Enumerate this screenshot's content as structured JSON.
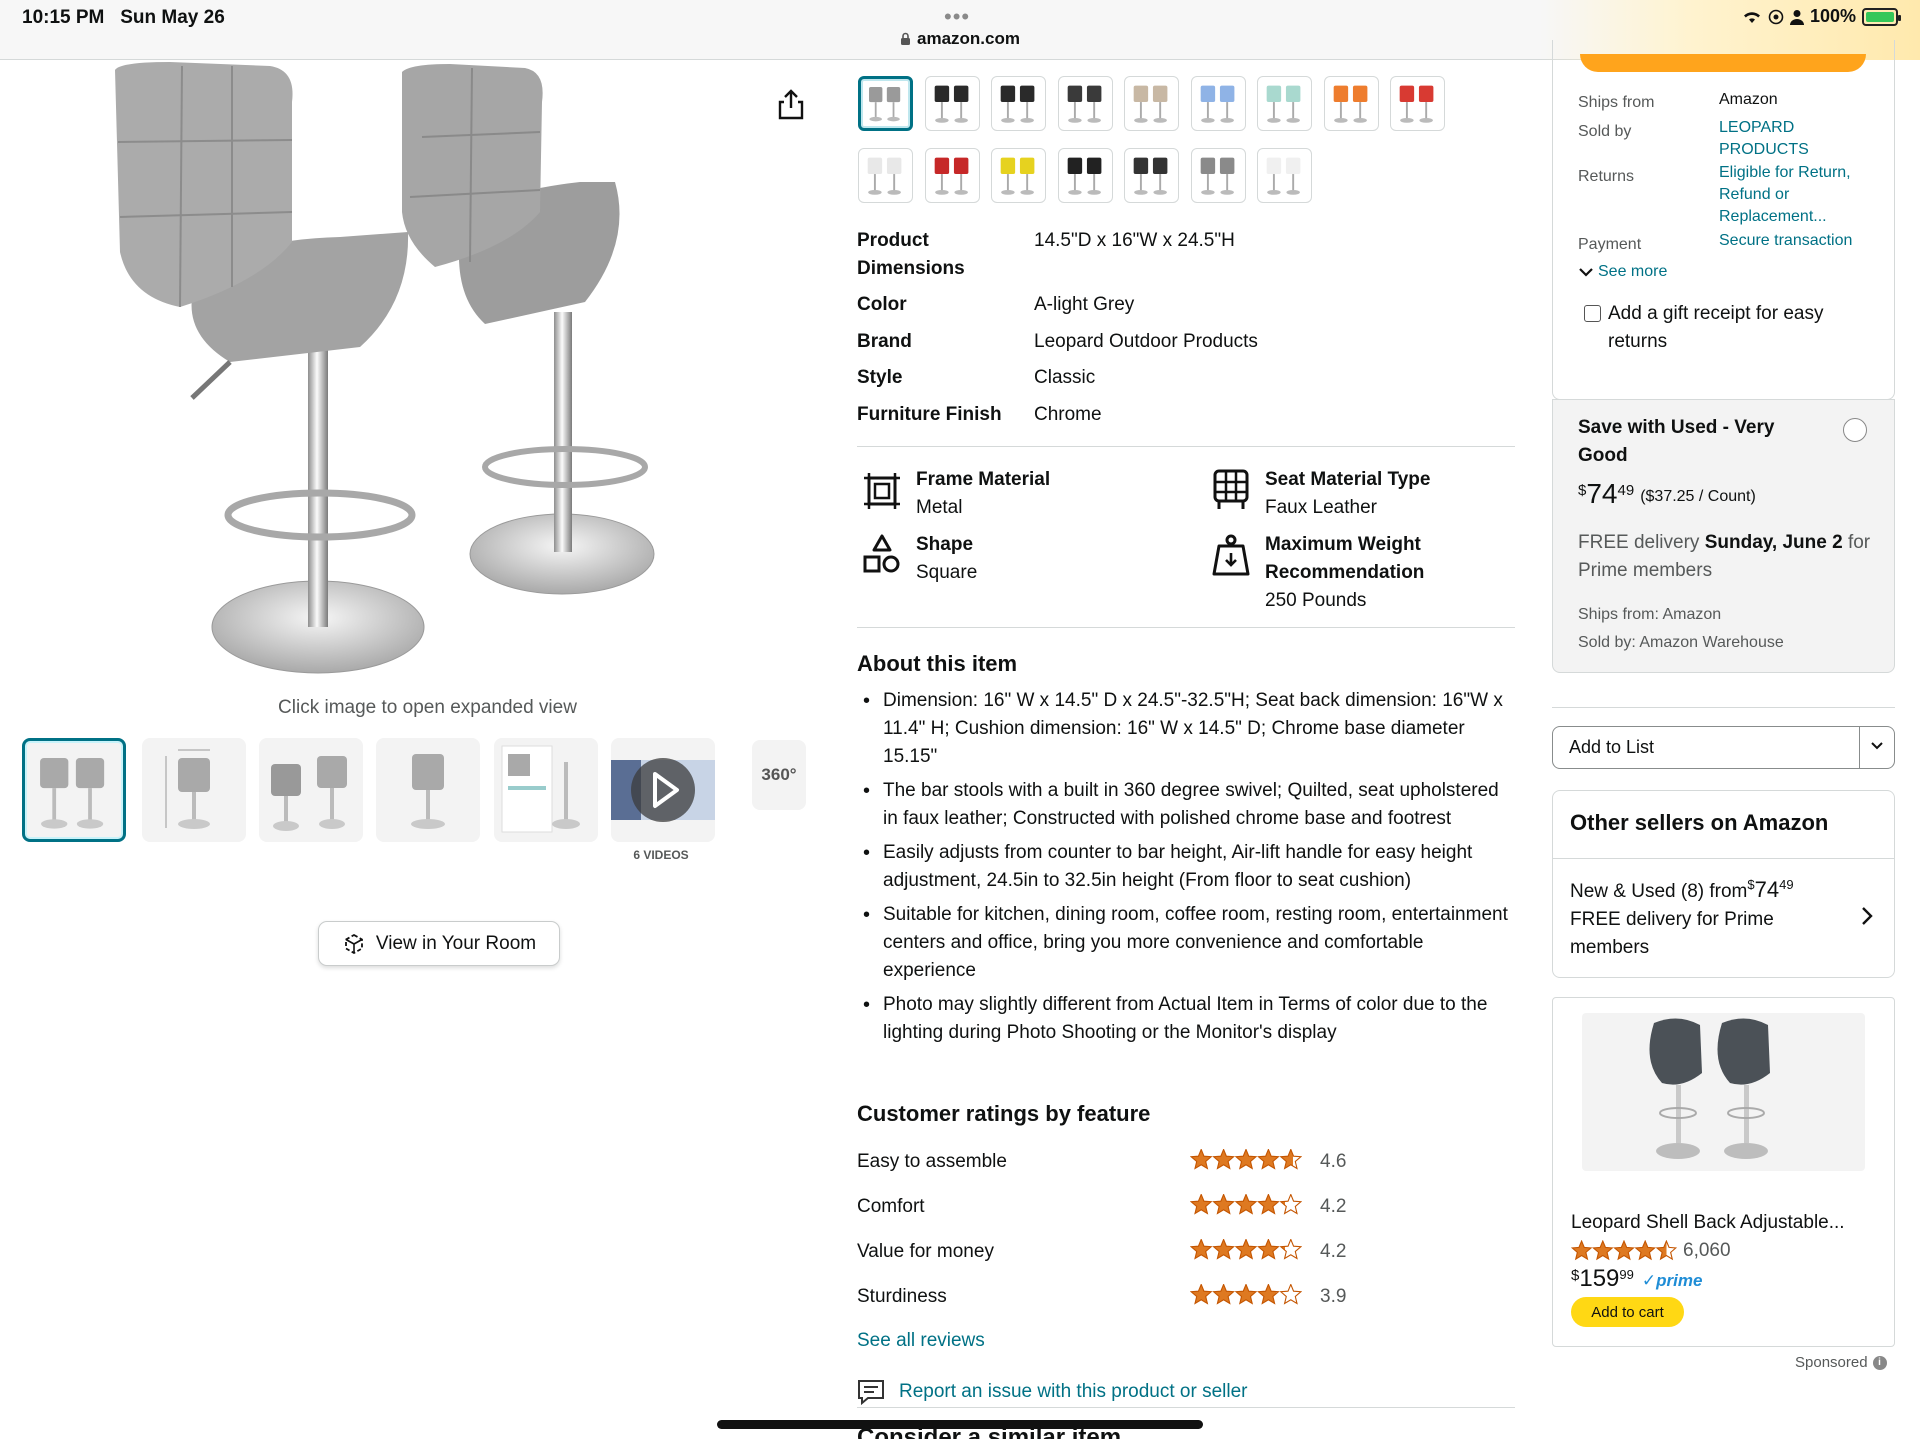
{
  "status_bar": {
    "time": "10:15 PM",
    "date": "Sun May 26",
    "url": "amazon.com",
    "battery": "100%"
  },
  "gallery": {
    "expand_hint": "Click image to open expanded view",
    "videos_label": "6 VIDEOS",
    "view_360": "360°",
    "view_in_room": "View in Your Room"
  },
  "swatch_colors": [
    "#9a9a9a",
    "#2a2a2a",
    "#2a2a2a",
    "#3a3a3a",
    "#c8b8a4",
    "#8fb3e6",
    "#a9d9cf",
    "#ee7d2e",
    "#d83a32",
    "#e8e8e8",
    "#c62828",
    "#e6d21f",
    "#222222",
    "#333333",
    "#8a8a8a",
    "#f0f0f0"
  ],
  "specs": [
    {
      "label": "Product Dimensions",
      "value": "14.5\"D x 16\"W x 24.5\"H"
    },
    {
      "label": "Color",
      "value": "A-light Grey"
    },
    {
      "label": "Brand",
      "value": "Leopard Outdoor Products"
    },
    {
      "label": "Style",
      "value": "Classic"
    },
    {
      "label": "Furniture Finish",
      "value": "Chrome"
    }
  ],
  "features": [
    {
      "title": "Frame Material",
      "value": "Metal",
      "icon": "frame-icon"
    },
    {
      "title": "Seat Material Type",
      "value": "Faux Leather",
      "icon": "seat-icon"
    },
    {
      "title": "Shape",
      "value": "Square",
      "icon": "shape-icon"
    },
    {
      "title": "Maximum Weight Recommendation",
      "value": "250 Pounds",
      "icon": "weight-icon"
    }
  ],
  "about": {
    "title": "About this item",
    "items": [
      "Dimension: 16\" W x 14.5\" D x 24.5\"-32.5\"H; Seat back dimension: 16\"W x 11.4\" H; Cushion dimension: 16\" W x 14.5\" D; Chrome base diameter 15.15\"",
      "The bar stools with a built in 360 degree swivel; Quilted, seat upholstered in faux leather; Constructed with polished chrome base and footrest",
      "Easily adjusts from counter to bar height, Air-lift handle for easy height adjustment, 24.5in to 32.5in height (From floor to seat cushion)",
      "Suitable for kitchen, dining room, coffee room, resting room, entertainment centers and office, bring you more convenience and comfortable experience",
      "Photo may slightly different from Actual Item in Terms of color due to the lighting during Photo Shooting or the Monitor's display"
    ]
  },
  "ratings": {
    "title": "Customer ratings by feature",
    "items": [
      {
        "label": "Easy to assemble",
        "value": "4.6",
        "stars": 4.6
      },
      {
        "label": "Comfort",
        "value": "4.2",
        "stars": 4.2
      },
      {
        "label": "Value for money",
        "value": "4.2",
        "stars": 4.2
      },
      {
        "label": "Sturdiness",
        "value": "3.9",
        "stars": 3.9
      }
    ],
    "see_all": "See all reviews",
    "report": "Report an issue with this product or seller",
    "similar": "Consider a similar item"
  },
  "buybox": {
    "ships_from_label": "Ships from",
    "ships_from": "Amazon",
    "sold_by_label": "Sold by",
    "sold_by": "LEOPARD PRODUCTS",
    "returns_label": "Returns",
    "returns": "Eligible for Return, Refund or Replacement...",
    "payment_label": "Payment",
    "payment": "Secure transaction",
    "see_more": "See more",
    "gift": "Add a gift receipt for easy returns"
  },
  "used": {
    "title": "Save with Used - Very Good",
    "price_symbol": "$",
    "price_whole": "74",
    "price_fraction": "49",
    "unit_price": "($37.25 / Count)",
    "delivery_prefix": "FREE delivery ",
    "delivery_date": "Sunday, June 2",
    "delivery_suffix": " for Prime members",
    "ships": "Ships from: Amazon",
    "sold": "Sold by: Amazon Warehouse"
  },
  "add_to_list": "Add to List",
  "other_sellers": {
    "title": "Other sellers on Amazon",
    "line1_prefix": "New & Used (8) from ",
    "price_symbol": "$",
    "price_whole": "74",
    "price_fraction": "49",
    "line2": "FREE delivery for Prime members"
  },
  "ad": {
    "title": "Leopard Shell Back Adjustable...",
    "stars": 4.5,
    "review_count": "6,060",
    "price_symbol": "$",
    "price_whole": "159",
    "price_fraction": "99",
    "prime": "prime",
    "cart": "Add to cart",
    "sponsored": "Sponsored"
  }
}
